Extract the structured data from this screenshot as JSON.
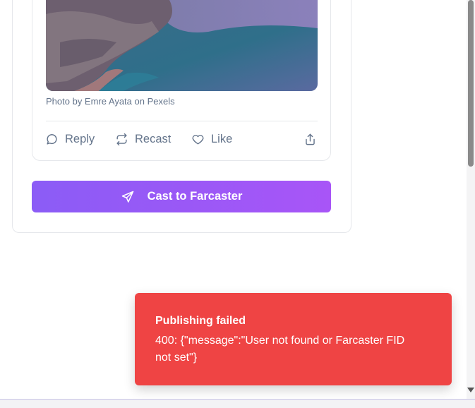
{
  "post": {
    "photo_credit": "Photo by Emre Ayata on Pexels",
    "actions": {
      "reply": "Reply",
      "recast": "Recast",
      "like": "Like"
    }
  },
  "cast_button": {
    "label": "Cast to Farcaster"
  },
  "toast": {
    "title": "Publishing failed",
    "message": "400: {\"message\":\"User not found or Farcaster FID not set\"}",
    "color": "#ef4444"
  },
  "colors": {
    "accent_gradient_start": "#8b5cf6",
    "accent_gradient_end": "#a855f7",
    "muted_text": "#64748b"
  }
}
